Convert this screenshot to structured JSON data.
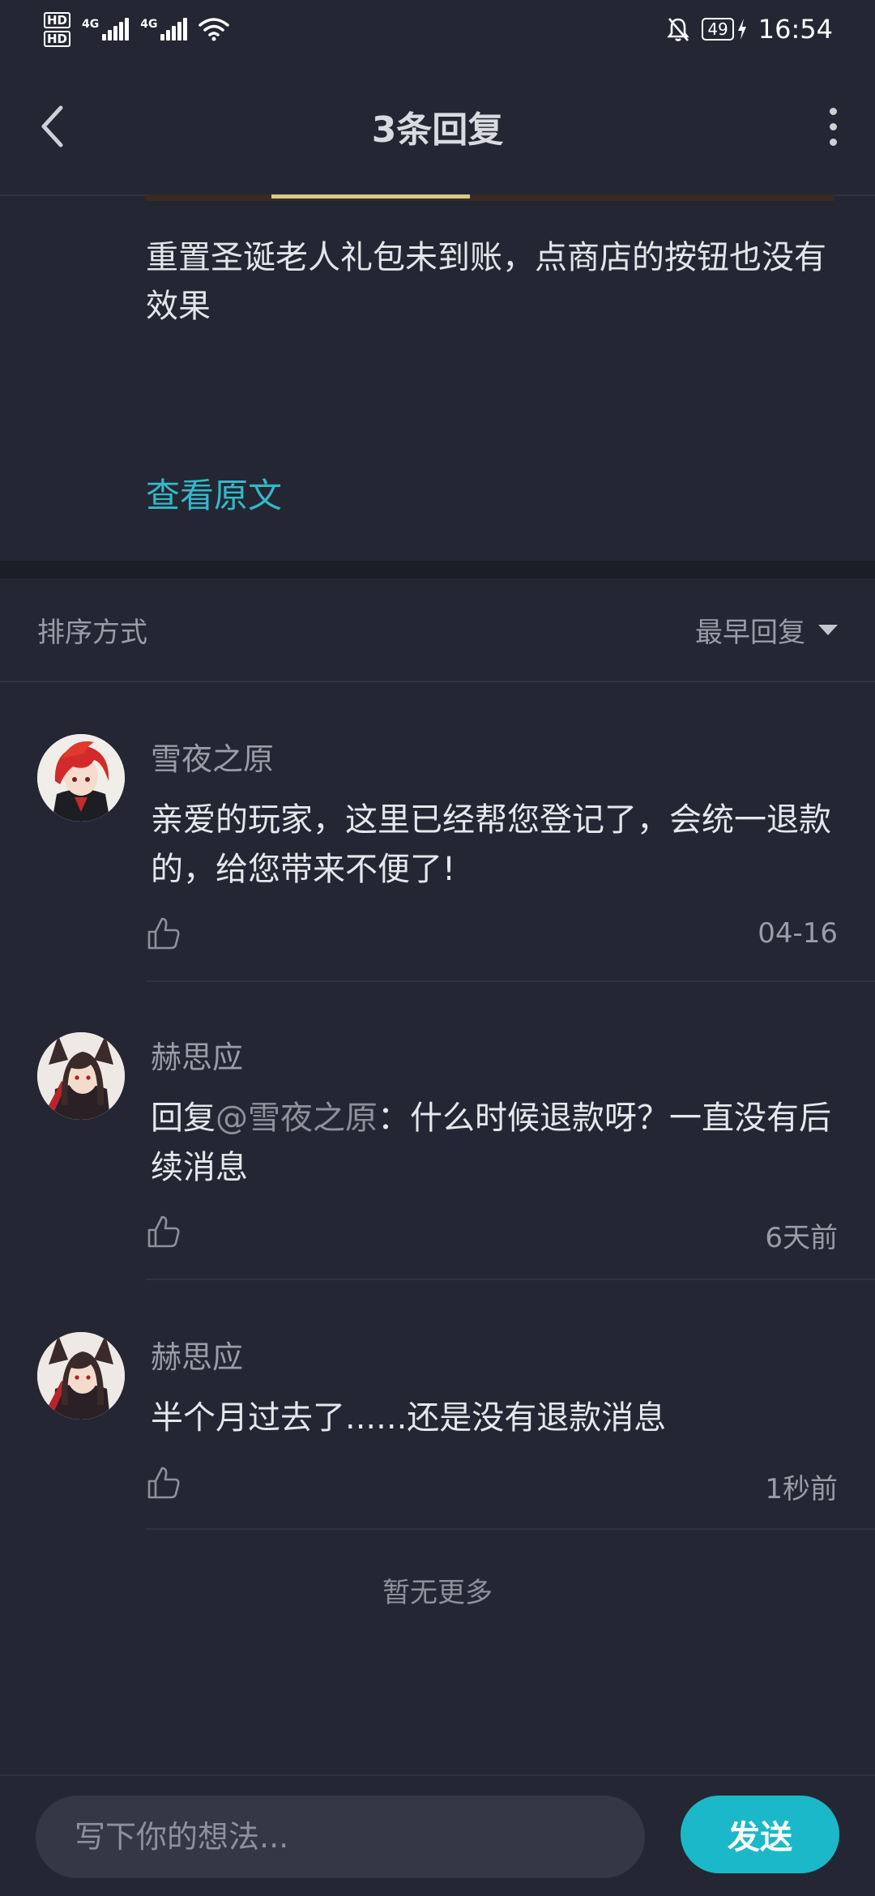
{
  "status_bar": {
    "sim1_label": "HD",
    "sim2_label": "HD",
    "network1": "4G",
    "network2": "4G",
    "battery": "49",
    "time": "16:54"
  },
  "header": {
    "title": "3条回复",
    "back_icon": "chevron-left-icon",
    "more_icon": "more-vertical-icon"
  },
  "post": {
    "text": "重置圣诞老人礼包未到账，点商店的按钮也没有效果",
    "view_original": "查看原文"
  },
  "sort": {
    "label": "排序方式",
    "selected": "最早回复"
  },
  "replies": [
    {
      "name": "雪夜之原",
      "content": "亲爱的玩家，这里已经帮您登记了，会统一退款的，给您带来不便了!",
      "time": "04-16"
    },
    {
      "name": "赫思应",
      "reply_prefix": "回复",
      "mention": "@雪夜之原",
      "content": "：什么时候退款呀？一直没有后续消息",
      "time": "6天前"
    },
    {
      "name": "赫思应",
      "content": "半个月过去了......还是没有退款消息",
      "time": "1秒前"
    }
  ],
  "no_more": "暂无更多",
  "composer": {
    "placeholder": "写下你的想法...",
    "value": "",
    "send_label": "发送"
  },
  "colors": {
    "background": "#242733",
    "accent": "#1ab8c9",
    "link": "#34b8c8"
  }
}
